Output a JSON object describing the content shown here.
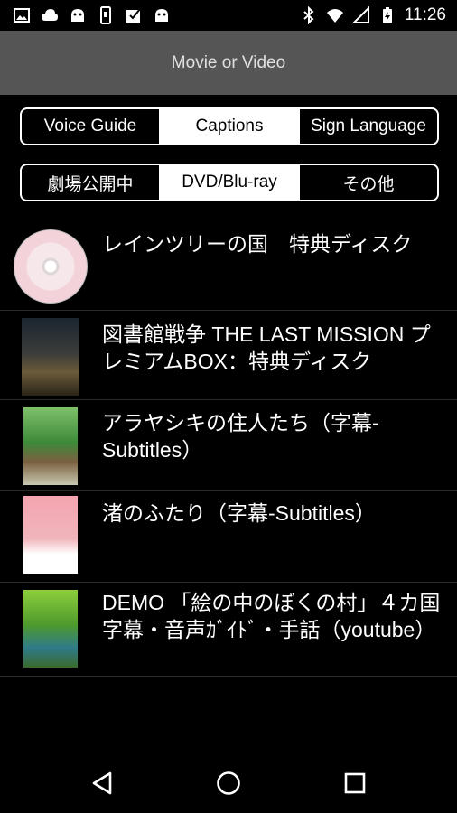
{
  "status_bar": {
    "time": "11:26",
    "left_icons": [
      "image-icon",
      "cloud-icon",
      "android-icon",
      "phone-icon",
      "checkbox-image-icon",
      "android-icon"
    ],
    "right_icons": [
      "bluetooth-icon",
      "wifi-icon",
      "signal-icon",
      "battery-charging-icon"
    ]
  },
  "action_bar": {
    "title": "Movie or Video"
  },
  "mode_tabs": [
    {
      "label": "Voice Guide",
      "active": false
    },
    {
      "label": "Captions",
      "active": true
    },
    {
      "label": "Sign Language",
      "active": false
    }
  ],
  "category_tabs": [
    {
      "label": "劇場公開中",
      "active": false
    },
    {
      "label": "DVD/Blu-ray",
      "active": true
    },
    {
      "label": "その他",
      "active": false
    }
  ],
  "items": [
    {
      "title": "レインツリーの国　特典ディスク"
    },
    {
      "title": "図書館戦争 THE LAST MISSION プレミアムBOX：特典ディスク"
    },
    {
      "title": "アラヤシキの住人たち（字幕-Subtitles）"
    },
    {
      "title": "渚のふたり（字幕-Subtitles）"
    },
    {
      "title": "DEMO 「絵の中のぼくの村」４カ国字幕・音声ｶﾞｲﾄﾞ・手話（youtube）"
    }
  ],
  "nav_bar": {
    "icons": [
      "back-icon",
      "home-icon",
      "recent-apps-icon"
    ]
  },
  "colors": {
    "background": "#000000",
    "action_bar": "#555555",
    "active_tab": "#ffffff"
  }
}
